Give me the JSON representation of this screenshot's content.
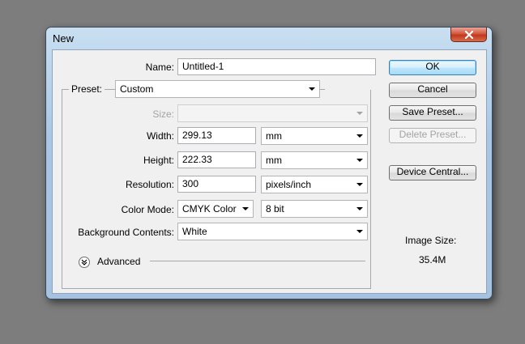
{
  "window": {
    "title": "New"
  },
  "form": {
    "name": {
      "label": "Name:",
      "value": "Untitled-1"
    },
    "preset": {
      "label": "Preset:",
      "value": "Custom"
    },
    "size": {
      "label": "Size:",
      "value": ""
    },
    "width": {
      "label": "Width:",
      "value": "299.13",
      "unit": "mm"
    },
    "height": {
      "label": "Height:",
      "value": "222.33",
      "unit": "mm"
    },
    "resolution": {
      "label": "Resolution:",
      "value": "300",
      "unit": "pixels/inch"
    },
    "color_mode": {
      "label": "Color Mode:",
      "value": "CMYK Color",
      "depth": "8 bit"
    },
    "background": {
      "label": "Background Contents:",
      "value": "White"
    },
    "advanced": {
      "label": "Advanced"
    }
  },
  "buttons": {
    "ok": "OK",
    "cancel": "Cancel",
    "save_preset": "Save Preset...",
    "delete_preset": "Delete Preset...",
    "device_central": "Device Central..."
  },
  "image_size": {
    "label": "Image Size:",
    "value": "35.4M"
  },
  "icons": {
    "close": "close-icon",
    "advanced": "chevron-double-down-icon",
    "dropdown": "caret-down-icon"
  }
}
